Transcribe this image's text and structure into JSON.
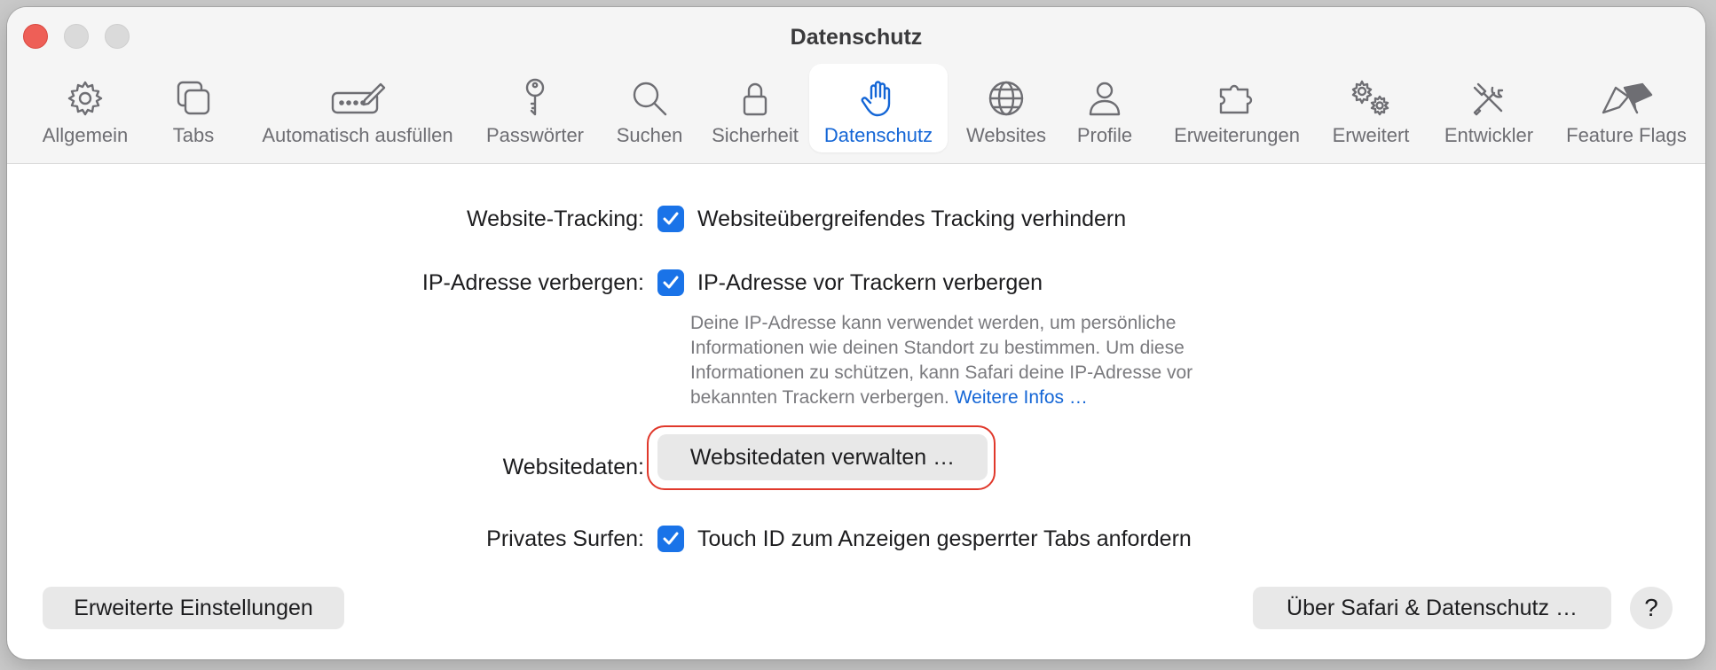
{
  "window": {
    "title": "Datenschutz"
  },
  "toolbar": {
    "items": [
      {
        "label": "Allgemein",
        "icon": "gear-icon"
      },
      {
        "label": "Tabs",
        "icon": "tabs-icon"
      },
      {
        "label": "Automatisch ausfüllen",
        "icon": "autofill-pencil-icon"
      },
      {
        "label": "Passwörter",
        "icon": "key-icon"
      },
      {
        "label": "Suchen",
        "icon": "magnifier-icon"
      },
      {
        "label": "Sicherheit",
        "icon": "lock-icon"
      },
      {
        "label": "Datenschutz",
        "icon": "hand-icon",
        "selected": true
      },
      {
        "label": "Websites",
        "icon": "globe-icon"
      },
      {
        "label": "Profile",
        "icon": "person-icon"
      },
      {
        "label": "Erweiterungen",
        "icon": "puzzle-icon"
      },
      {
        "label": "Erweitert",
        "icon": "gears-icon"
      },
      {
        "label": "Entwickler",
        "icon": "tools-icon"
      },
      {
        "label": "Feature Flags",
        "icon": "flags-icon"
      }
    ]
  },
  "settings": {
    "tracking": {
      "label": "Website-Tracking:",
      "checkbox_label": "Websiteübergreifendes Tracking verhindern",
      "checked": true
    },
    "ip": {
      "label": "IP-Adresse verbergen:",
      "checkbox_label": "IP-Adresse vor Trackern verbergen",
      "checked": true,
      "description": "Deine IP-Adresse kann verwendet werden, um persönliche Informationen wie deinen Standort zu bestimmen. Um diese Informationen zu schützen, kann Safari deine IP-Adresse vor bekannten Trackern verbergen.",
      "link": "Weitere Infos …"
    },
    "website_data": {
      "label": "Websitedaten:",
      "button": "Websitedaten verwalten …"
    },
    "private_browsing": {
      "label": "Privates Surfen:",
      "checkbox_label": "Touch ID zum Anzeigen gesperrter Tabs anfordern",
      "checked": true
    }
  },
  "footer": {
    "advanced_button": "Erweiterte Einstellungen",
    "about_button": "Über Safari & Datenschutz …",
    "help_button": "?"
  },
  "colors": {
    "accent": "#1466d6",
    "highlight_ring": "#e0382b",
    "close": "#ee5f57"
  }
}
